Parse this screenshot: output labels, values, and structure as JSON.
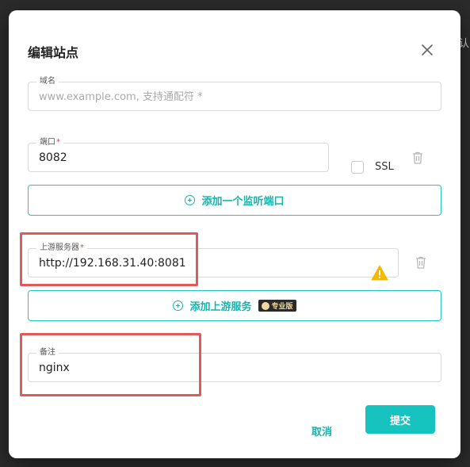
{
  "background_peek": "认",
  "dialog": {
    "title": "编辑站点",
    "domain_field": {
      "label": "域名",
      "placeholder": "www.example.com, 支持通配符 *",
      "value": ""
    },
    "port_field": {
      "label": "端口",
      "required_mark": "*",
      "value": "8082"
    },
    "ssl_label": "SSL",
    "add_port_button": "添加一个监听端口",
    "upstream_field": {
      "label": "上游服务器",
      "required_mark": "*",
      "value": "http://192.168.31.40:8081"
    },
    "add_upstream_button": "添加上游服务",
    "pro_badge": "专业版",
    "note_field": {
      "label": "备注",
      "value": "nginx"
    },
    "cancel_button": "取消",
    "submit_button": "提交"
  },
  "colors": {
    "accent": "#16c3be",
    "highlight": "#e05a5a",
    "warning": "#f5b800"
  }
}
